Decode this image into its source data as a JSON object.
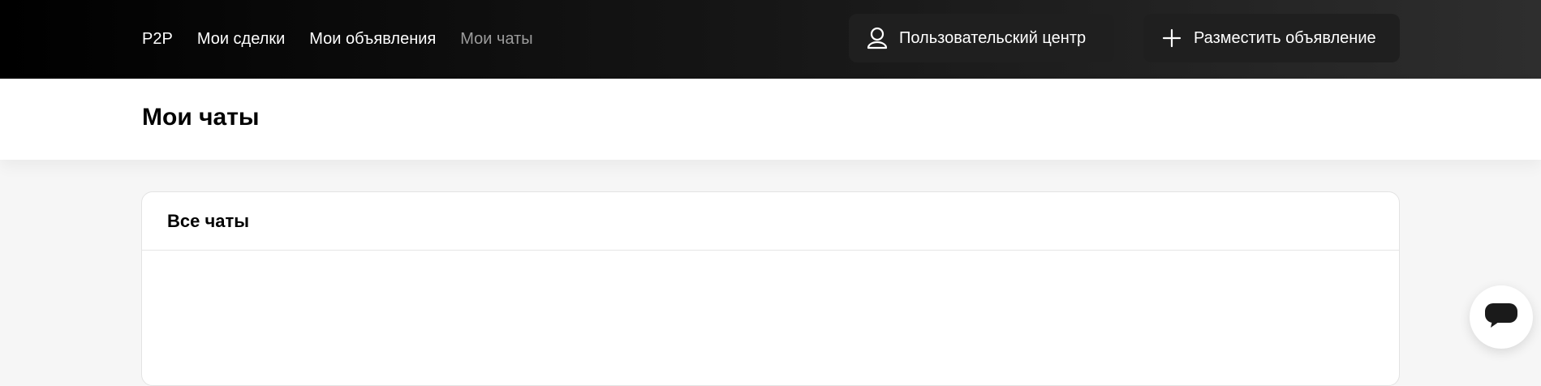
{
  "nav": {
    "items": [
      {
        "label": "P2P",
        "active": false
      },
      {
        "label": "Мои сделки",
        "active": false
      },
      {
        "label": "Мои объявления",
        "active": false
      },
      {
        "label": "Мои чаты",
        "active": true
      }
    ]
  },
  "actions": {
    "user_center_label": "Пользовательский центр",
    "user_center_icon": "user-icon",
    "post_ad_label": "Разместить объявление",
    "post_ad_icon": "plus-icon"
  },
  "page": {
    "title": "Мои чаты"
  },
  "chats_card": {
    "title": "Все чаты"
  },
  "support": {
    "icon": "chat-bubble-icon"
  },
  "colors": {
    "topbar_start": "#000000",
    "topbar_end": "#2e2e2e",
    "nav_active": "#9c9c9c",
    "button_bg": "#1f1f1f"
  }
}
